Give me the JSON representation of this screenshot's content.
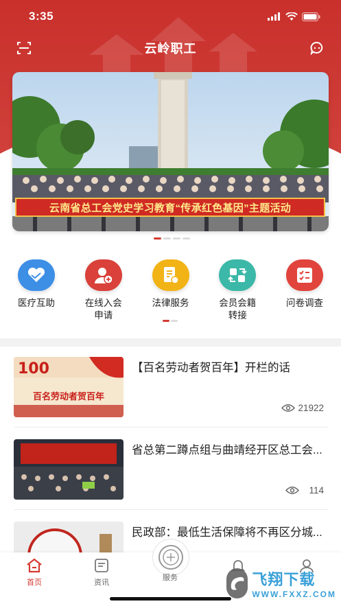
{
  "status_bar": {
    "time": "3:35"
  },
  "nav": {
    "title": "云岭职工"
  },
  "banner": {
    "caption": "云南省总工会党史学习教育“传承红色基因”主题活动",
    "dot_count": 4,
    "active_index": 0
  },
  "services": [
    {
      "label": "医疗互助",
      "icon": "handshake-heart-icon",
      "color": "#3d8fe6"
    },
    {
      "label": "在线入会\n申请",
      "icon": "add-user-icon",
      "color": "#d9413a"
    },
    {
      "label": "法律服务",
      "icon": "legal-document-icon",
      "color": "#f2b316"
    },
    {
      "label": "会员会籍\n转接",
      "icon": "transfer-icon",
      "color": "#3cb8a8"
    },
    {
      "label": "问卷调查",
      "icon": "checklist-icon",
      "color": "#e0443c"
    }
  ],
  "news": [
    {
      "title": "【百名劳动者贺百年】开栏的话",
      "views": "21922",
      "thumb_text": "百名劳动者贺百年"
    },
    {
      "title": "省总第二蹲点组与曲靖经开区总工会...",
      "views": "114"
    },
    {
      "title": "民政部：最低生活保障将不再区分城..."
    }
  ],
  "tabs": [
    {
      "label": "首页",
      "icon": "home-icon",
      "active": true
    },
    {
      "label": "资讯",
      "icon": "news-icon",
      "active": false
    },
    {
      "label": "服务",
      "icon": "service-icon",
      "active": false
    },
    {
      "label": "",
      "icon": "bell-icon",
      "active": false
    },
    {
      "label": "",
      "icon": "user-icon",
      "active": false
    }
  ],
  "watermark": {
    "main": "飞翔下载",
    "sub": "WWW.FXXZ.COM"
  },
  "colors": {
    "brand_red": "#d43a31",
    "accent_gold": "#f3c24a"
  }
}
